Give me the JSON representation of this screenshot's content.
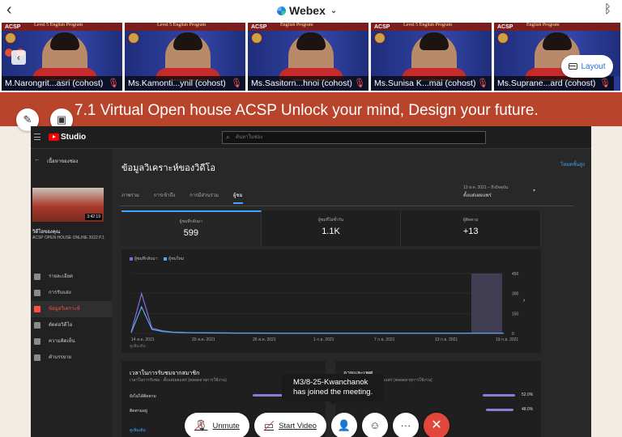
{
  "app": {
    "title": "Webex",
    "back_icon": "chevron-left-icon",
    "dropdown_icon": "chevron-down-icon",
    "bluetooth_icon": "bluetooth-icon"
  },
  "participants": [
    {
      "name": "M.Narongrit...asri (cohost)",
      "banner": "Level 5 English Program",
      "acsp": "ACSP"
    },
    {
      "name": "Ms.Kamonti...ynil (cohost)",
      "banner": "Level 5 English Program",
      "acsp": ""
    },
    {
      "name": "Ms.Sasitorn...hnoi (cohost)",
      "banner": "English Program",
      "acsp": "ACSP"
    },
    {
      "name": "Ms.Sunisa K...mai (cohost)",
      "banner": "Level 5 English Program",
      "acsp": "ACSP"
    },
    {
      "name": "Ms.Suprane...ard (cohost)",
      "banner": "English Program",
      "acsp": "ACSP"
    }
  ],
  "layout_button": {
    "label": "Layout",
    "icon": "layout-icon"
  },
  "slide": {
    "title": "7.1  Virtual Open house ACSP Unlock your mind, Design your future."
  },
  "studio": {
    "logo": "Studio",
    "search_placeholder": "ค้นหาในช่อง",
    "side": {
      "channel": "เนื้อหาของช่อง",
      "video_title": "วิดีโอของคุณ",
      "video_sub": "ACSP OPEN HOUSE ONLINE 2022 P.1",
      "duration": "3:42:19",
      "items": [
        "รายละเอียด",
        "การรับแสง",
        "ข้อมูลวิเคราะห์",
        "ตัดต่อวิดีโอ",
        "ความคิดเห็น",
        "คำบรรยาย"
      ]
    },
    "main": {
      "title": "ข้อมูลวิเคราะห์ของวิดีโอ",
      "link": "โหมดขั้นสูง",
      "date_range": "13 ส.ค. 2021 – ถึงปัจจุบัน",
      "date_value": "ตั้งแต่เผยแพร่",
      "tabs": [
        "ภาพรวม",
        "การเข้าถึง",
        "การมีส่วนร่วม",
        "ผู้ชม"
      ],
      "metrics": [
        {
          "label": "ผู้ชมที่กลับมา",
          "value": "599"
        },
        {
          "label": "ผู้ชมที่ไม่ซ้ำกัน",
          "value": "1.1K"
        },
        {
          "label": "ผู้ติดตาม",
          "value": "+13"
        }
      ],
      "legend": [
        "ผู้ชมที่กลับมา",
        "ผู้ชมใหม่"
      ],
      "chart_more": "ดูเพิ่มเติม",
      "cards": [
        {
          "title": "เวลาในการรับชมจากสมาชิก",
          "sub": "เวลาในการรับชม · ตั้งแต่เผยแพร่ (ตลอดอายุการใช้งาน)",
          "rows": [
            {
              "label": "ยังไม่ได้ติดตาม",
              "pct": ""
            },
            {
              "label": "ติดตามอยู่",
              "pct": ""
            }
          ],
          "more": "ดูเพิ่มเติม"
        },
        {
          "title": "อายุและเพศ",
          "sub": "จำนวนการดู · ตั้งแต่เผยแพร่ (ตลอดอายุการใช้งาน)",
          "rows": [
            {
              "label": "",
              "pct": "52.0%"
            },
            {
              "label": "",
              "pct": "48.0%"
            }
          ],
          "more": ""
        }
      ]
    }
  },
  "chart_data": {
    "type": "line",
    "x": [
      "14 ส.ค. 2021",
      "20 ส.ค. 2021",
      "26 ส.ค. 2021",
      "1 ก.ย. 2021",
      "7 ก.ย. 2021",
      "13 ก.ย. 2021",
      "19 ก.ย. 2021"
    ],
    "yticks": [
      0,
      150,
      300,
      450
    ],
    "ylim": [
      0,
      450
    ],
    "series": [
      {
        "name": "ผู้ชมที่กลับมา",
        "color": "#7c6fe0",
        "values": [
          10,
          300,
          40,
          20,
          10,
          8,
          5,
          5,
          4,
          4,
          3,
          3,
          3,
          2,
          2,
          2,
          2,
          2,
          2,
          2,
          2,
          2,
          2,
          2,
          2,
          2,
          2,
          2,
          2,
          2,
          2,
          2,
          2,
          2,
          2,
          2,
          2
        ]
      },
      {
        "name": "ผู้ชมใหม่",
        "color": "#5aa8e8",
        "values": [
          5,
          200,
          30,
          15,
          8,
          6,
          4,
          4,
          3,
          3,
          2,
          2,
          2,
          2,
          1,
          1,
          1,
          1,
          1,
          1,
          1,
          1,
          1,
          1,
          1,
          1,
          1,
          1,
          1,
          1,
          1,
          1,
          1,
          1,
          1,
          1,
          1
        ]
      }
    ]
  },
  "toast": {
    "line1": "M3/8-25-Kwanchanok",
    "line2": "has joined the meeting."
  },
  "controls": {
    "unmute": "Unmute",
    "start_video": "Start Video"
  }
}
